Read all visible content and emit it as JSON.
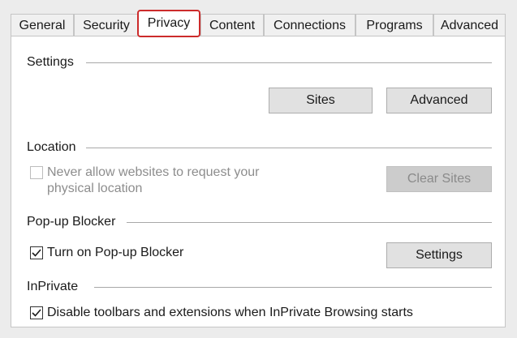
{
  "tabs": [
    {
      "label": "General",
      "active": false
    },
    {
      "label": "Security",
      "active": false
    },
    {
      "label": "Privacy",
      "active": true
    },
    {
      "label": "Content",
      "active": false
    },
    {
      "label": "Connections",
      "active": false
    },
    {
      "label": "Programs",
      "active": false
    },
    {
      "label": "Advanced",
      "active": false
    }
  ],
  "settings": {
    "title": "Settings",
    "sites_button": "Sites",
    "advanced_button": "Advanced"
  },
  "location": {
    "title": "Location",
    "checkbox_label_line1": "Never allow websites to request your",
    "checkbox_label_line2": "physical location",
    "checked": false,
    "enabled": false,
    "clear_sites_button": "Clear Sites"
  },
  "popup": {
    "title": "Pop-up Blocker",
    "checkbox_label": "Turn on Pop-up Blocker",
    "checked": true,
    "settings_button": "Settings"
  },
  "inprivate": {
    "title": "InPrivate",
    "checkbox_label": "Disable toolbars and extensions when InPrivate Browsing starts",
    "checked": true
  },
  "colors": {
    "active_tab_highlight": "#cc2b2b",
    "panel_background": "#ffffff",
    "button_background": "#e1e1e1"
  }
}
